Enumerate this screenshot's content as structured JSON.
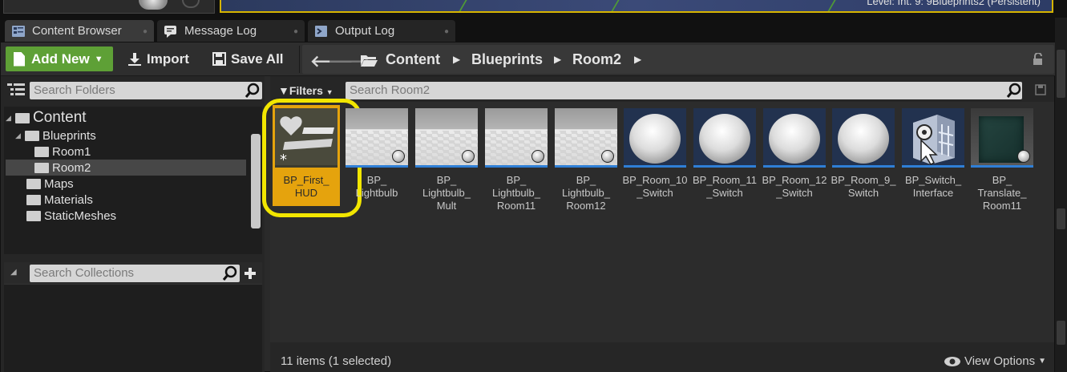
{
  "viewport": {
    "level_label": "Level:  Int. 9: 9Blueprints2 (Persistent)"
  },
  "tabs": [
    {
      "label": "Content Browser",
      "icon": "content-browser-icon",
      "active": true
    },
    {
      "label": "Message Log",
      "icon": "message-log-icon",
      "active": false
    },
    {
      "label": "Output Log",
      "icon": "output-log-icon",
      "active": false
    }
  ],
  "toolbar": {
    "add_new_label": "Add New",
    "import_label": "Import",
    "save_all_label": "Save All"
  },
  "breadcrumb": {
    "items": [
      "Content",
      "Blueprints",
      "Room2"
    ]
  },
  "folders": {
    "search_placeholder": "Search Folders",
    "tree": [
      {
        "label": "Content",
        "depth": 0,
        "expanded": true,
        "selected": false
      },
      {
        "label": "Blueprints",
        "depth": 1,
        "expanded": true,
        "selected": false
      },
      {
        "label": "Room1",
        "depth": 2,
        "expanded": false,
        "selected": false
      },
      {
        "label": "Room2",
        "depth": 2,
        "expanded": false,
        "selected": true
      },
      {
        "label": "Maps",
        "depth": 1,
        "expanded": false,
        "selected": false
      },
      {
        "label": "Materials",
        "depth": 1,
        "expanded": false,
        "selected": false
      },
      {
        "label": "StaticMeshes",
        "depth": 1,
        "expanded": false,
        "selected": false
      }
    ]
  },
  "collections": {
    "search_placeholder": "Search Collections"
  },
  "filters": {
    "label": "Filters",
    "search_placeholder": "Search Room2"
  },
  "assets": [
    {
      "label": "BP_First_\nHUD",
      "thumb": "hud",
      "selected": true
    },
    {
      "label": "BP_\nLightbulb",
      "thumb": "floor",
      "selected": false
    },
    {
      "label": "BP_\nLightbulb_\nMult",
      "thumb": "floor",
      "selected": false
    },
    {
      "label": "BP_\nLightbulb_\nRoom11",
      "thumb": "floor",
      "selected": false
    },
    {
      "label": "BP_\nLightbulb_\nRoom12",
      "thumb": "floor",
      "selected": false
    },
    {
      "label": "BP_Room_10\n_Switch",
      "thumb": "sphere",
      "selected": false
    },
    {
      "label": "BP_Room_11\n_Switch",
      "thumb": "sphere",
      "selected": false
    },
    {
      "label": "BP_Room_12\n_Switch",
      "thumb": "sphere",
      "selected": false
    },
    {
      "label": "BP_Room_9_\nSwitch",
      "thumb": "sphere",
      "selected": false
    },
    {
      "label": "BP_Switch_\nInterface",
      "thumb": "iface",
      "selected": false
    },
    {
      "label": "BP_\nTranslate_\nRoom11",
      "thumb": "cube",
      "selected": false
    }
  ],
  "status": {
    "items_text": "11 items (1 selected)",
    "view_options_label": "View Options"
  },
  "colors": {
    "add_new_green": "#5ea036",
    "selection_orange": "#e5a30d",
    "highlight_yellow": "#f2e600",
    "thumb_bar_blue": "#2f7fd6"
  }
}
